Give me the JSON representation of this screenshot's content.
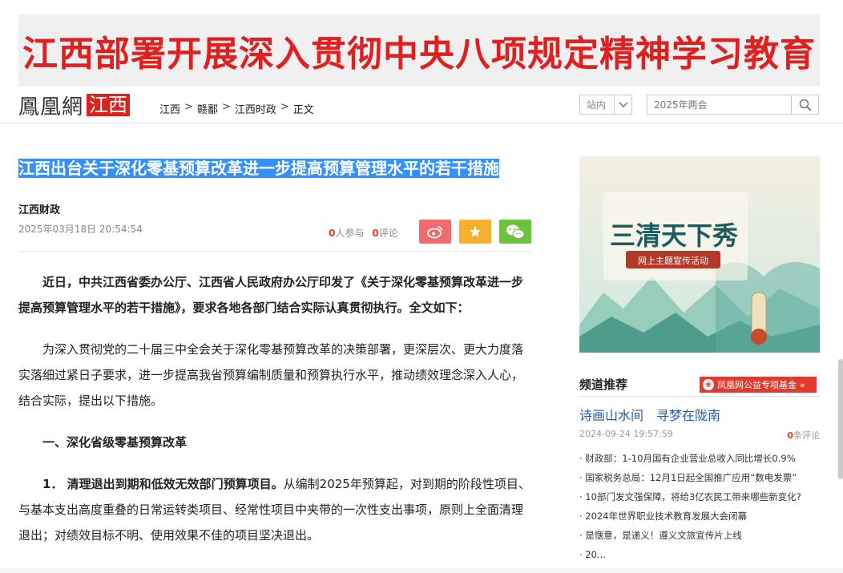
{
  "banner": {
    "text": "江西部署开展深入贯彻中央八项规定精神学习教育"
  },
  "header": {
    "logo_main": "鳳凰網",
    "logo_region": "江西",
    "breadcrumb": [
      "江西",
      "赣鄱",
      "江西时政",
      "正文"
    ],
    "breadcrumb_sep": ">",
    "site_select": "站内",
    "search_placeholder": "2025年两会"
  },
  "article": {
    "title": "江西出台关于深化零基预算改革进一步提高预算管理水平的若干措施",
    "source": "江西财政",
    "date": "2025年03月18日 20:54:54",
    "participants_count": "0",
    "participants_label": "人参与",
    "comments_count": "0",
    "comments_label": "评论",
    "paragraphs": {
      "lead": "近日，中共江西省委办公厅、江西省人民政府办公厅印发了《关于深化零基预算改革进一步提高预算管理水平的若干措施》，要求各地各部门结合实际认真贯彻执行。全文如下：",
      "intro": "为深入贯彻党的二十届三中全会关于深化零基预算改革的决策部署，更深层次、更大力度落实落细过紧日子要求，进一步提高我省预算编制质量和预算执行水平，推动绩效理念深入人心，结合实际，提出以下措施。",
      "section1": "一、深化省级零基预算改革",
      "item1_head": "1． 清理退出到期和低效无效部门预算项目。",
      "item1_body": "从编制2025年预算起，对到期的阶段性项目、与基本支出高度重叠的日常运转类项目、经常性项目中夹带的一次性支出事项，原则上全面清理退出；对绩效目标不明、使用效果不佳的项目坚决退出。"
    }
  },
  "sidebar": {
    "ad": {
      "title": "三清天下秀",
      "subtitle": "网上主题宣传活动",
      "colors": {
        "sky": "#dff0ea",
        "mountain": "#5fae9f",
        "title": "#1f5a5c",
        "xiu": "#c0392b",
        "ribbon": "#b33a2a"
      }
    },
    "section_title": "频道推荐",
    "fund_badge": "凤凰网公益专项基金",
    "fund_arrow": "»",
    "feature_title": "诗画山水间　寻梦在陇南",
    "feature_date": "2024-09-24 19:57:59",
    "feature_comments_count": "0",
    "feature_comments_label": "条评论",
    "news": [
      "· 财政部：1-10月国有企业营业总收入同比增长0.9%",
      "· 国家税务总局：12月1日起全国推广应用“数电发票”",
      "· 10部门发文强保障，将给3亿农民工带来哪些新变化?",
      "· 2024年世界职业技术教育发展大会闭幕",
      "· 是惬意，是递义！遵义文旅宣传片上线",
      "· 20..."
    ]
  },
  "colors": {
    "accent_red": "#e02020",
    "link_blue": "#1f5cab",
    "selection": "#3390ff"
  }
}
